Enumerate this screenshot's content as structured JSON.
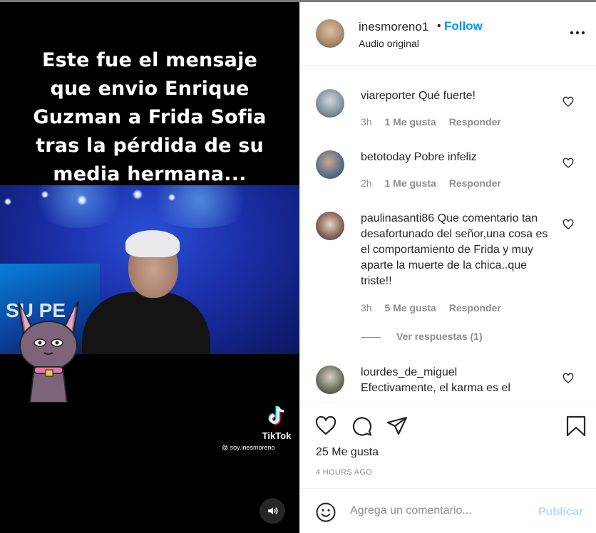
{
  "video": {
    "caption_lines": [
      "Este fue el mensaje",
      "que envio Enrique",
      "Guzman a Frida Sofia",
      "tras la pérdida de su",
      "media hermana..."
    ],
    "watermark": "TikTok",
    "handle": "@ soy.inesmoreno",
    "icons": {
      "tiktok": "tiktok-logo-icon",
      "volume": "volume-icon"
    }
  },
  "header": {
    "username": "inesmoreno1",
    "separator": "•",
    "follow_label": "Follow",
    "subtitle": "Audio original"
  },
  "comments": [
    {
      "user": "viareporter",
      "text": "Qué fuerte!",
      "age": "3h",
      "likes": "1 Me gusta",
      "reply": "Responder"
    },
    {
      "user": "betotoday",
      "text": "Pobre infeliz",
      "age": "2h",
      "likes": "1 Me gusta",
      "reply": "Responder"
    },
    {
      "user": "paulinasanti86",
      "text": "Que comentario tan desafortunado del señor,una cosa es el comportamiento de Frida y muy aparte la muerte de la chica..que triste!!",
      "age": "3h",
      "likes": "5 Me gusta",
      "reply": "Responder"
    },
    {
      "user": "lourdes_de_miguel",
      "text": "Efectivamente, el karma es el"
    }
  ],
  "view_replies": "Ver respuestas (1)",
  "actions": {
    "icons": [
      "heart-icon",
      "comment-icon",
      "share-icon",
      "bookmark-icon"
    ],
    "likes": "25 Me gusta",
    "timestamp": "4 HOURS AGO"
  },
  "add_comment": {
    "placeholder": "Agrega un comentario...",
    "post_label": "Publicar"
  },
  "colors": {
    "follow": "#0095f6",
    "publish_disabled": "#b3dbff",
    "muted": "#8e8e8e"
  }
}
